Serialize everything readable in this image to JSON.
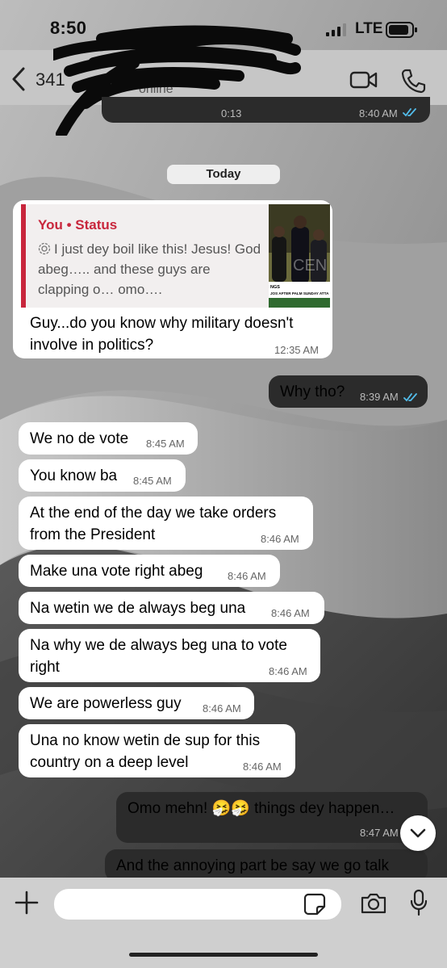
{
  "status_bar": {
    "time": "8:50",
    "network": "LTE"
  },
  "header": {
    "contact_name": "341",
    "contact_status": "online"
  },
  "voice_note": {
    "duration": "0:13",
    "time": "8:40 AM"
  },
  "date_divider": "Today",
  "reply_message": {
    "quote_author": "You • Status",
    "quote_text": "I just dey boil like this! Jesus! God abeg….. and these guys are clapping o… omo….",
    "thumb_caption": "JOS AFTER PALM SUNDAY ATTA",
    "thumb_letters": "CEN",
    "thumb_tag": "NGS",
    "text": "Guy...do you know why military doesn't involve in politics?",
    "time": "12:35 AM"
  },
  "messages": [
    {
      "direction": "out",
      "text": "Why tho?",
      "time": "8:39 AM"
    },
    {
      "direction": "in",
      "text": "We no de vote",
      "time": "8:45 AM"
    },
    {
      "direction": "in",
      "text": "You know ba",
      "time": "8:45 AM"
    },
    {
      "direction": "in",
      "text": "At the end of the day we take orders from the President",
      "time": "8:46 AM"
    },
    {
      "direction": "in",
      "text": "Make una vote right abeg",
      "time": "8:46 AM"
    },
    {
      "direction": "in",
      "text": "Na wetin we de always beg una",
      "time": "8:46 AM"
    },
    {
      "direction": "in",
      "text": "Na why we de always beg una to vote right",
      "time": "8:46 AM"
    },
    {
      "direction": "in",
      "text": "We are powerless guy",
      "time": "8:46 AM"
    },
    {
      "direction": "in",
      "text": "Una no know wetin de sup for this country on a deep level",
      "time": "8:46 AM"
    },
    {
      "direction": "out",
      "text": "Omo mehn! 🤧🤧 things dey happen…",
      "time": "8:47 AM"
    },
    {
      "direction": "out",
      "text": "And the annoying part be say we go talk",
      "time": ""
    }
  ],
  "composer": {
    "value": "",
    "placeholder": ""
  },
  "icons": {
    "back": "chevron-left-icon",
    "video": "video-camera-icon",
    "phone": "phone-icon",
    "plus": "plus-icon",
    "sticker": "sticker-icon",
    "camera": "camera-icon",
    "mic": "microphone-icon",
    "scroll": "chevron-down-icon",
    "read": "double-check-icon"
  },
  "colors": {
    "incoming_bubble": "#ffffff",
    "outgoing_bubble": "#2b2b2b",
    "read_ticks": "#53bdeb",
    "status_accent": "#c8263c"
  }
}
